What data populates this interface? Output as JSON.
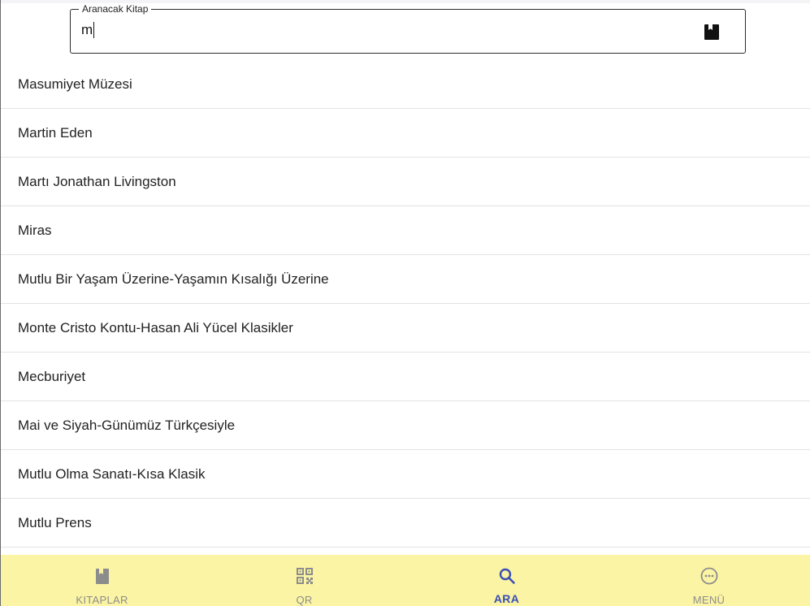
{
  "search": {
    "legend": "Aranacak Kitap",
    "value": "m",
    "icon": "book-icon"
  },
  "books": [
    "Masumiyet Müzesi",
    "Martin Eden",
    "Martı Jonathan Livingston",
    "Miras",
    "Mutlu Bir Yaşam Üzerine-Yaşamın Kısalığı Üzerine",
    "Monte Cristo Kontu-Hasan Ali Yücel Klasikler",
    "Mecburiyet",
    "Mai ve Siyah-Günümüz Türkçesiyle",
    "Mutlu Olma Sanatı-Kısa Klasik",
    "Mutlu Prens"
  ],
  "bottom_nav": {
    "items": [
      {
        "label": "KITAPLAR",
        "icon": "book-icon",
        "active": false
      },
      {
        "label": "QR",
        "icon": "qr-code-icon",
        "active": false
      },
      {
        "label": "ARA",
        "icon": "search-icon",
        "active": true
      },
      {
        "label": "MENÜ",
        "icon": "more-horizontal-circle-icon",
        "active": false
      }
    ]
  },
  "colors": {
    "nav_background": "#fbf4a4",
    "active_accent": "#3a4fb5",
    "inactive": "#8c8c8c",
    "divider": "#e3e3e3"
  }
}
